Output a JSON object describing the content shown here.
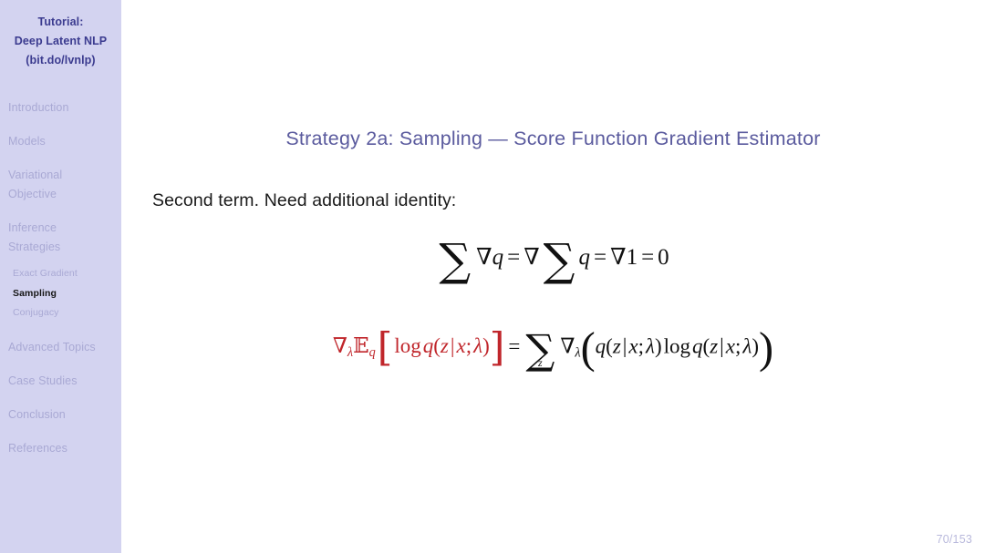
{
  "sidebar": {
    "header": {
      "line1": "Tutorial:",
      "line2": "Deep Latent NLP",
      "line3": "(bit.do/lvnlp)"
    },
    "sections": [
      {
        "label": "Introduction"
      },
      {
        "label": "Models"
      },
      {
        "label_line1": "Variational",
        "label_line2": "Objective"
      },
      {
        "label_line1": "Inference",
        "label_line2": "Strategies"
      },
      {
        "label": "Advanced Topics"
      },
      {
        "label": "Case Studies"
      },
      {
        "label": "Conclusion"
      },
      {
        "label": "References"
      }
    ],
    "subsections": [
      {
        "label": "Exact Gradient",
        "active": false
      },
      {
        "label": "Sampling",
        "active": true
      },
      {
        "label": "Conjugacy",
        "active": false
      }
    ]
  },
  "slide": {
    "title": "Strategy 2a: Sampling — Score Function Gradient Estimator",
    "body_text": "Second term. Need additional identity:",
    "equation1": {
      "latex": "\\sum \\nabla q = \\nabla \\sum q = \\nabla 1 = 0",
      "plain": "∑ ∇q = ∇ ∑ q = ∇1 = 0"
    },
    "equation2": {
      "latex": "\\nabla_\\lambda \\mathbb{E}_q\\left[\\log q(z \\mid x; \\lambda)\\right] = \\sum_z \\nabla_\\lambda\\left(q(z \\mid x; \\lambda)\\log q(z \\mid x; \\lambda)\\right)",
      "plain": "∇λ 𝔼q[ log q(z | x; λ) ] = ∑z ∇λ( q(z | x; λ) log q(z | x; λ) )",
      "lhs_color": "#c0262b",
      "tokens": {
        "nabla": "∇",
        "lambda": "λ",
        "expectation": "E",
        "q": "q",
        "log": "log",
        "z": "z",
        "x": "x",
        "mid": "|",
        "semicolon": ";",
        "equals": "=",
        "sum": "∑",
        "one": "1",
        "zero": "0"
      }
    }
  },
  "footer": {
    "page_number": "70/153"
  },
  "colors": {
    "sidebar_bg": "#d3d3f0",
    "sidebar_header_text": "#3b3b8f",
    "sidebar_nav_text": "#a9a9d4",
    "sidebar_active_text": "#151515",
    "title_text": "#5b5b9e",
    "body_text": "#1a1a1a",
    "math_text": "#111111",
    "accent_red": "#c0262b",
    "page_number_text": "#b9b9dc",
    "slide_bg": "#ffffff"
  }
}
